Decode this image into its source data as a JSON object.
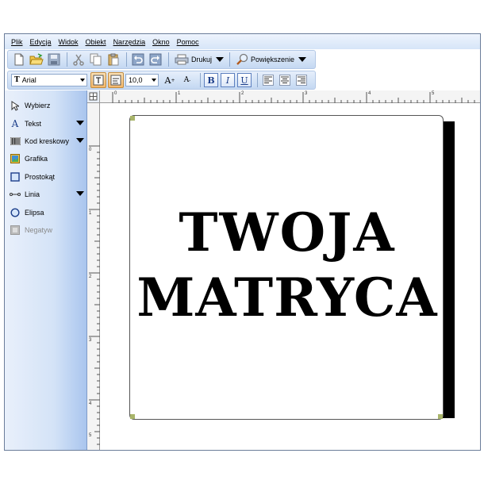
{
  "menu": {
    "items": [
      "Plik",
      "Edycja",
      "Widok",
      "Obiekt",
      "Narzędzia",
      "Okno",
      "Pomoc"
    ]
  },
  "toolbar": {
    "print_label": "Drukuj",
    "zoom_label": "Powiększenie"
  },
  "format_bar": {
    "font_name": "Arial",
    "font_size": "10,0",
    "bold_label": "B",
    "italic_label": "I",
    "underline_label": "U",
    "grow_font_label": "A",
    "shrink_font_label": "A"
  },
  "tools": {
    "items": [
      {
        "label": "Wybierz",
        "icon": "pointer-icon",
        "has_dropdown": false,
        "enabled": true
      },
      {
        "label": "Tekst",
        "icon": "text-icon",
        "has_dropdown": true,
        "enabled": true
      },
      {
        "label": "Kod kreskowy",
        "icon": "barcode-icon",
        "has_dropdown": true,
        "enabled": true
      },
      {
        "label": "Grafika",
        "icon": "image-icon",
        "has_dropdown": false,
        "enabled": true
      },
      {
        "label": "Prostokąt",
        "icon": "rectangle-icon",
        "has_dropdown": false,
        "enabled": true
      },
      {
        "label": "Linia",
        "icon": "line-icon",
        "has_dropdown": true,
        "enabled": true
      },
      {
        "label": "Elipsa",
        "icon": "ellipse-icon",
        "has_dropdown": false,
        "enabled": true
      },
      {
        "label": "Negatyw",
        "icon": "negative-icon",
        "has_dropdown": false,
        "enabled": false
      }
    ]
  },
  "rulers": {
    "top_numbers": [
      "0",
      "1",
      "2",
      "3",
      "4",
      "5"
    ],
    "left_numbers": [
      "0",
      "1",
      "2",
      "3",
      "4",
      "5"
    ]
  },
  "label": {
    "line1": "TWOJA",
    "line2": "MATRYCA"
  },
  "colors": {
    "panel_blue": "#a9c5ee",
    "toolbar_blue": "#c4d8f2",
    "active_orange": "#f5b86b",
    "text_tool_blue": "#1c3e8a"
  }
}
